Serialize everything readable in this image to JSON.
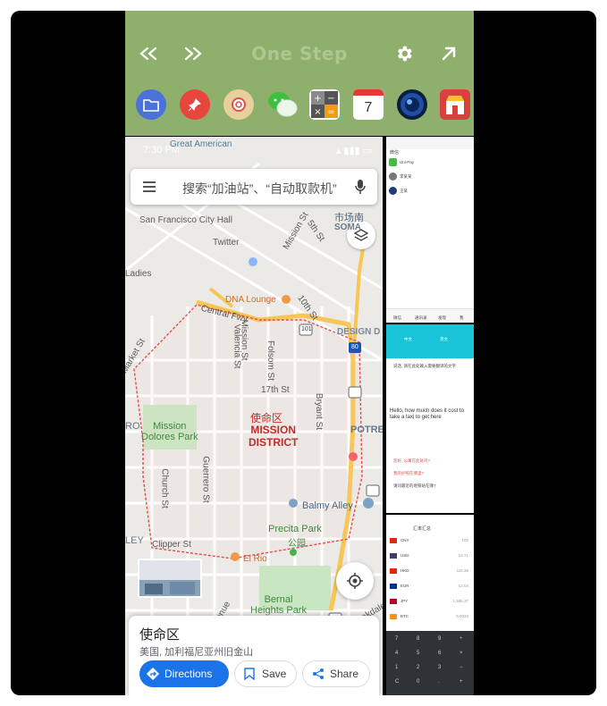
{
  "onestep": {
    "title": "One Step",
    "buttons": [
      "back-double-icon",
      "forward-double-icon",
      "gear-icon",
      "expand-arrow-icon"
    ],
    "apps": [
      {
        "name": "folder-app-icon",
        "color": "#4a72d9"
      },
      {
        "name": "pin-app-icon",
        "color": "#e8453c"
      },
      {
        "name": "search-app-icon",
        "color": "#e9cf9b"
      },
      {
        "name": "wechat-app-icon",
        "color": "#3fbf3f"
      },
      {
        "name": "calculator-app-icon",
        "color": "#eeeeee"
      },
      {
        "name": "calendar-app-icon",
        "color": "#ffffff"
      },
      {
        "name": "camera-app-icon",
        "color": "#1e4fa8"
      },
      {
        "name": "store-app-icon",
        "color": "#d94141"
      }
    ],
    "calendar_day": "7"
  },
  "maps": {
    "status_time": "7:30 PM",
    "search_placeholder": "搜索“加油站”、“自动取款机”",
    "labels": {
      "great_american": "Great American",
      "city_hall": "San Francisco City Hall",
      "twitter": "Twitter",
      "market_cn": "市场南",
      "soma": "SOMA",
      "ladies": "Ladies",
      "dna": "DNA Lounge",
      "central_fwy": "Central Fwy",
      "design_d": "DESIGN D",
      "mission_cn": "使命区",
      "mission_district": "MISSION\nDISTRICT",
      "mission_dolores": "Mission\nDolores Park",
      "potre": "POTRE",
      "balmy": "Balmy Alley",
      "precita": "Precita Park",
      "precita_cn": "公园",
      "el_rio": "El Rio",
      "bernal": "Bernal\nHeights Park",
      "clipper": "Clipper St",
      "oakdale": "Oakdale",
      "valencia": "Valencia St",
      "mission_st": "Mission St",
      "folsom": "Folsom St",
      "17th": "17th St",
      "bryant": "Bryant St",
      "guerrero": "Guerrero St",
      "church": "Church St",
      "market": "Market St",
      "10th": "10th St",
      "mission_st2": "Mission St",
      "fifth": "5th St",
      "ro": "RO",
      "ley": "LEY",
      "avenue": "Avenue",
      "shield_101": "101",
      "shield_80": "80"
    },
    "place": {
      "title": "使命区",
      "subtitle": "美国, 加利福尼亚州旧金山",
      "directions": "Directions",
      "save": "Save",
      "share": "Share"
    }
  },
  "thumbs": {
    "wechat": {
      "title": "微信",
      "rows": [
        "Uni-Pay",
        "李某某",
        "王某"
      ],
      "tabs": [
        "微信",
        "通讯录",
        "发现",
        "我"
      ]
    },
    "translator": {
      "lang_from": "中文",
      "lang_to": "英文",
      "prompt": "说话, 请在此处输入需要翻译的文字",
      "english": "Hello, how much does it cost to take a taxi to get here",
      "history": [
        "您好, 公寓在此处吗?",
        "我的护照在哪里?",
        "请问最近的地铁站在哪?"
      ]
    },
    "currency": {
      "title": "汇率汇总",
      "rows": [
        {
          "code": "CNY",
          "value": "100",
          "color": "#de2910"
        },
        {
          "code": "USD",
          "value": "14.71",
          "color": "#3c3b6e"
        },
        {
          "code": "HKD",
          "value": "115.36",
          "color": "#de2910"
        },
        {
          "code": "EUR",
          "value": "13.04",
          "color": "#003399"
        },
        {
          "code": "JPY",
          "value": "1,595.37",
          "color": "#bc002d"
        },
        {
          "code": "BTC",
          "value": "0.0020",
          "color": "#f7931a"
        }
      ],
      "keys": [
        "7",
        "8",
        "9",
        "÷",
        "4",
        "5",
        "6",
        "×",
        "1",
        "2",
        "3",
        "−",
        "C",
        "0",
        ".",
        "+"
      ]
    }
  }
}
